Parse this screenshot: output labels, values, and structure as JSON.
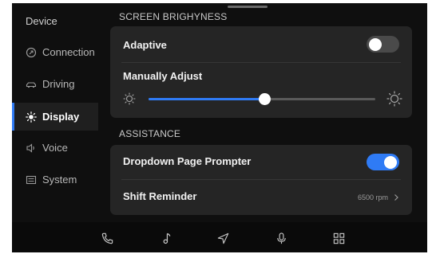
{
  "sidebar": {
    "title": "Device",
    "items": [
      {
        "label": "Connection",
        "icon": "connection-icon"
      },
      {
        "label": "Driving",
        "icon": "car-icon"
      },
      {
        "label": "Display",
        "icon": "sun-icon",
        "active": true
      },
      {
        "label": "Voice",
        "icon": "speaker-icon"
      },
      {
        "label": "System",
        "icon": "system-icon"
      }
    ]
  },
  "screen_brightness": {
    "title": "SCREEN BRIGHYNESS",
    "adaptive": {
      "label": "Adaptive",
      "enabled": false
    },
    "manual": {
      "label": "Manually Adjust",
      "level": 0.51
    }
  },
  "assistance": {
    "title": "ASSISTANCE",
    "dropdown_prompter": {
      "label": "Dropdown Page Prompter",
      "enabled": true
    },
    "shift_reminder": {
      "label": "Shift Reminder",
      "value": "6500 rpm"
    }
  },
  "bottom_bar": [
    "phone-icon",
    "music-icon",
    "navigation-icon",
    "microphone-icon",
    "apps-grid-icon"
  ],
  "colors": {
    "accent": "#2f7bf5",
    "background": "#0f0f0f",
    "card": "#252525"
  }
}
